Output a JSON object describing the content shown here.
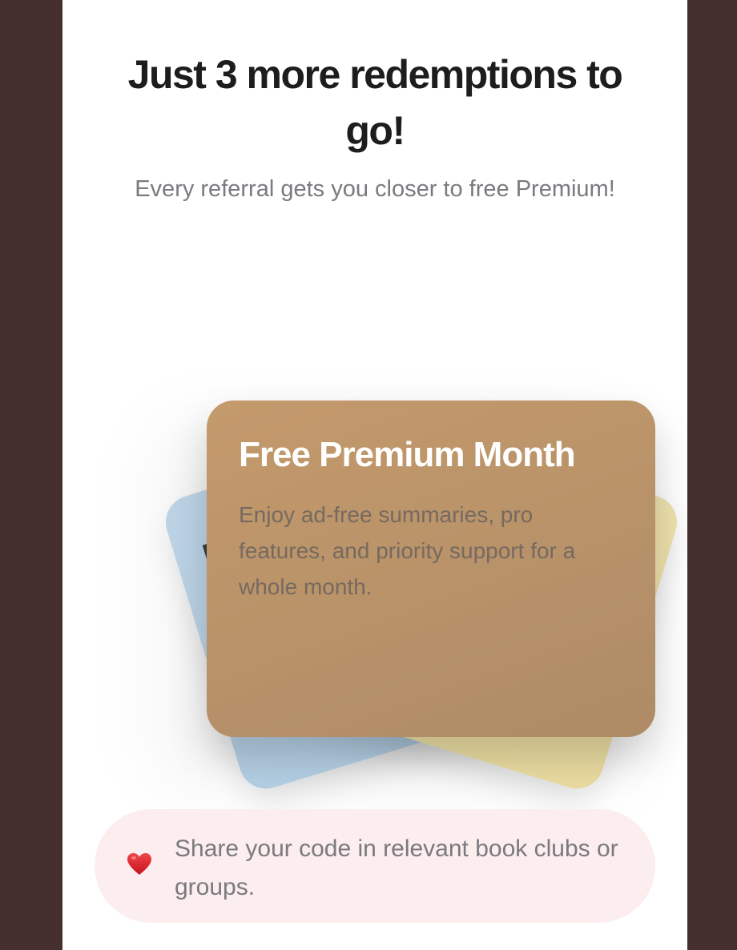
{
  "header": {
    "title": "Just 3 more redemptions to go!",
    "subtitle": "Every referral gets you closer to free Premium!"
  },
  "cards": {
    "back_left": {
      "peek_text": "E",
      "color": "#b4cfe4"
    },
    "back_right": {
      "color": "#ecdfa8"
    },
    "front": {
      "title": "Free Premium Month",
      "description": "Enjoy ad-free summaries, pro features, and priority support for a whole month.",
      "color": "#b9926a"
    }
  },
  "tip": {
    "icon": "heart-icon",
    "text": "Share your code in relevant book clubs or groups.",
    "background": "#fcedee"
  },
  "colors": {
    "outer_background": "#442f2d",
    "panel_background": "#ffffff",
    "heart": "#e0202e"
  }
}
